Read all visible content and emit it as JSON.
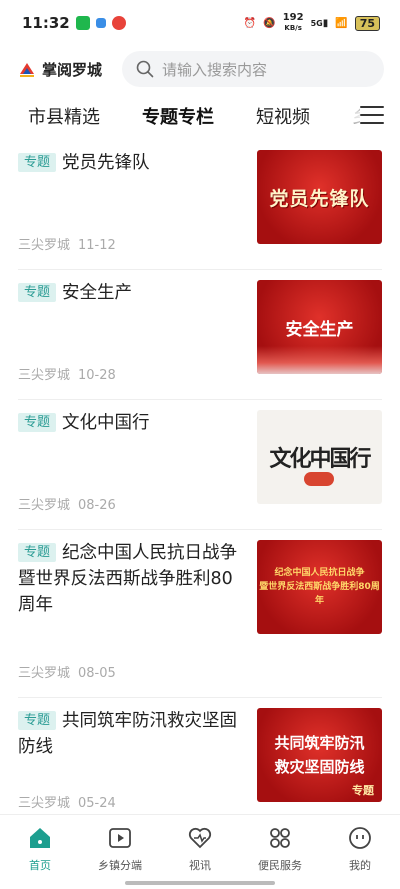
{
  "status": {
    "time": "11:32",
    "net_speed_value": "192",
    "net_speed_unit": "KB/s",
    "signal": "5G",
    "battery": "75"
  },
  "header": {
    "brand": "掌阅罗城",
    "search_placeholder": "请输入搜索内容"
  },
  "tabs": [
    {
      "label": "市县精选",
      "active": false
    },
    {
      "label": "专题专栏",
      "active": true
    },
    {
      "label": "短视频",
      "active": false
    },
    {
      "label": "乡",
      "active": false
    }
  ],
  "items": [
    {
      "tag": "专题",
      "title": "党员先锋队",
      "source": "三尖罗城",
      "date": "11-12",
      "thumb_text": "党员先锋队"
    },
    {
      "tag": "专题",
      "title": "安全生产",
      "source": "三尖罗城",
      "date": "10-28",
      "thumb_text": "安全生产"
    },
    {
      "tag": "专题",
      "title": "文化中国行",
      "source": "三尖罗城",
      "date": "08-26",
      "thumb_text": "文化中国行"
    },
    {
      "tag": "专题",
      "title": "纪念中国人民抗日战争暨世界反法西斯战争胜利80周年",
      "source": "三尖罗城",
      "date": "08-05",
      "thumb_line1": "纪念中国人民抗日战争",
      "thumb_line2": "暨世界反法西斯战争胜利80周年"
    },
    {
      "tag": "专题",
      "title": "共同筑牢防汛救灾坚固防线",
      "source": "三尖罗城",
      "date": "05-24",
      "thumb_line1": "共同筑牢防汛",
      "thumb_line2": "救灾坚固防线",
      "thumb_badge": "专题"
    }
  ],
  "nav": [
    {
      "label": "首页",
      "icon": "home-icon",
      "active": true
    },
    {
      "label": "乡镇分端",
      "icon": "play-icon",
      "active": false
    },
    {
      "label": "视讯",
      "icon": "heart-icon",
      "active": false
    },
    {
      "label": "便民服务",
      "icon": "grid-icon",
      "active": false
    },
    {
      "label": "我的",
      "icon": "face-icon",
      "active": false
    }
  ],
  "colors": {
    "accent": "#1d9e8f",
    "tag_bg": "#dcf1ef",
    "tag_text": "#2a9c94"
  }
}
